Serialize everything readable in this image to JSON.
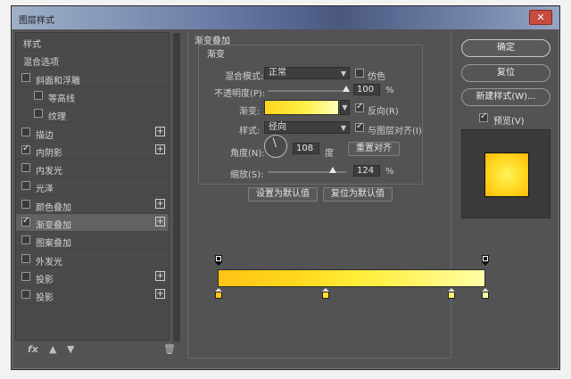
{
  "window": {
    "title": "图层样式",
    "close_label": "✕"
  },
  "styles": [
    {
      "label": "样式",
      "checkbox": false,
      "checked": false,
      "plus": false,
      "indent": 0
    },
    {
      "label": "混合选项",
      "checkbox": false,
      "checked": false,
      "plus": false,
      "indent": 0
    },
    {
      "label": "斜面和浮雕",
      "checkbox": true,
      "checked": false,
      "plus": false,
      "indent": 0
    },
    {
      "label": "等高线",
      "checkbox": true,
      "checked": false,
      "plus": false,
      "indent": 1
    },
    {
      "label": "纹理",
      "checkbox": true,
      "checked": false,
      "plus": false,
      "indent": 1
    },
    {
      "label": "描边",
      "checkbox": true,
      "checked": false,
      "plus": true,
      "indent": 0
    },
    {
      "label": "内阴影",
      "checkbox": true,
      "checked": true,
      "plus": true,
      "indent": 0
    },
    {
      "label": "内发光",
      "checkbox": true,
      "checked": false,
      "plus": false,
      "indent": 0
    },
    {
      "label": "光泽",
      "checkbox": true,
      "checked": false,
      "plus": false,
      "indent": 0
    },
    {
      "label": "颜色叠加",
      "checkbox": true,
      "checked": false,
      "plus": true,
      "indent": 0
    },
    {
      "label": "渐变叠加",
      "checkbox": true,
      "checked": true,
      "plus": true,
      "indent": 0,
      "selected": true
    },
    {
      "label": "图案叠加",
      "checkbox": true,
      "checked": false,
      "plus": false,
      "indent": 0
    },
    {
      "label": "外发光",
      "checkbox": true,
      "checked": false,
      "plus": false,
      "indent": 0
    },
    {
      "label": "投影",
      "checkbox": true,
      "checked": false,
      "plus": true,
      "indent": 0
    },
    {
      "label": "投影",
      "checkbox": true,
      "checked": false,
      "plus": true,
      "indent": 0
    }
  ],
  "bottom": {
    "fx_label": "fx",
    "up_icon": "arrow-up-icon",
    "down_icon": "arrow-down-icon",
    "trash_icon": "trash-icon"
  },
  "panel": {
    "group_title": "渐变叠加",
    "sub_title": "渐变",
    "blend_mode_label": "混合模式:",
    "blend_mode_value": "正常",
    "dither_label": "仿色",
    "opacity_label": "不透明度(P):",
    "opacity_value": "100",
    "opacity_percent": 100,
    "percent": "%",
    "gradient_label": "渐变:",
    "reverse_label": "反向(R)",
    "style_label": "样式:",
    "style_value": "径向",
    "align_label": "与图层对齐(I)",
    "angle_label": "角度(N):",
    "angle_value": "108",
    "degree": "度",
    "reset_align_label": "重置对齐",
    "scale_label": "缩放(S):",
    "scale_value": "124",
    "scale_percent": 124,
    "make_default_label": "设置为默认值",
    "reset_default_label": "复位为默认值",
    "gradient_colors": [
      "#ffc414",
      "#ffec34",
      "#ffffa8"
    ]
  },
  "right": {
    "ok_label": "确定",
    "reset_label": "复位",
    "new_style_label": "新建样式(W)...",
    "preview_label": "预览(V)"
  },
  "colors": {
    "accent": "#ffd820",
    "bg": "#535353"
  }
}
